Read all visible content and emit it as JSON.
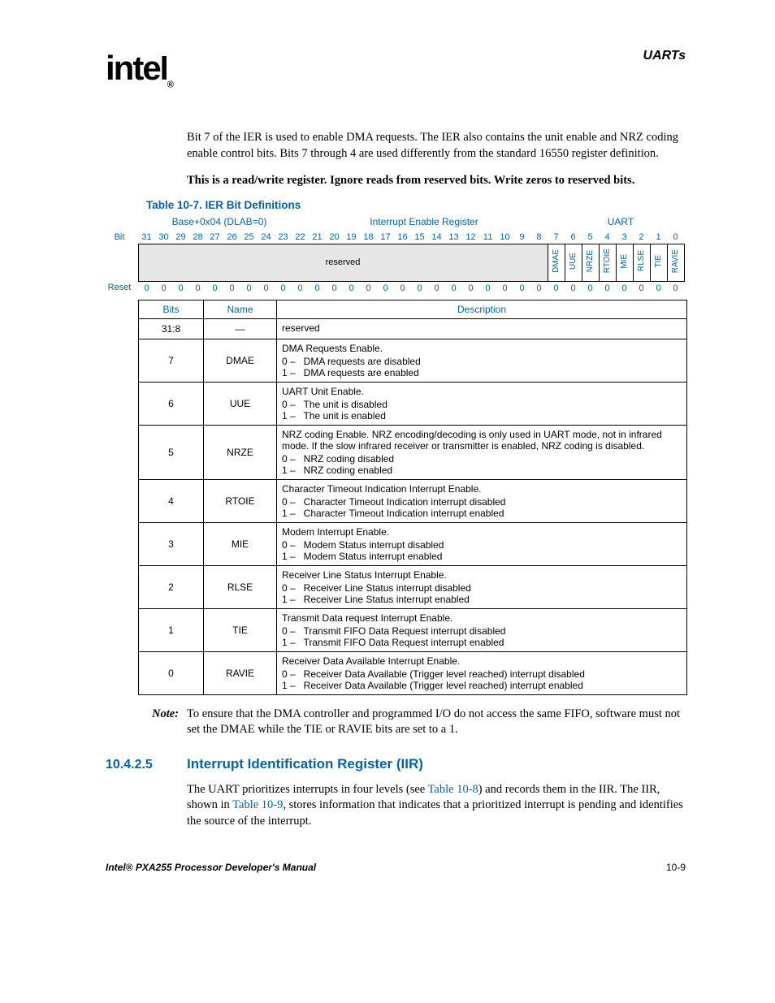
{
  "header": {
    "logo": "intel",
    "section": "UARTs"
  },
  "paras": {
    "p1": "Bit 7 of the IER is used to enable DMA requests. The IER also contains the unit enable and NRZ coding enable control bits. Bits 7 through 4 are used differently from the standard 16550 register definition.",
    "p2": "This is a read/write register. Ignore reads from reserved bits. Write zeros to reserved bits."
  },
  "table_caption": "Table 10-7. IER Bit Definitions",
  "reg_header": {
    "addr": "Base+0x04 (DLAB=0)",
    "name": "Interrupt Enable Register",
    "module": "UART"
  },
  "bit_labels": {
    "bit": "Bit",
    "reset": "Reset"
  },
  "bit_numbers": [
    "31",
    "30",
    "29",
    "28",
    "27",
    "26",
    "25",
    "24",
    "23",
    "22",
    "21",
    "20",
    "19",
    "18",
    "17",
    "16",
    "15",
    "14",
    "13",
    "12",
    "11",
    "10",
    "9",
    "8",
    "7",
    "6",
    "5",
    "4",
    "3",
    "2",
    "1",
    "0"
  ],
  "field_reserved": "reserved",
  "field_names": [
    "DMAE",
    "UUE",
    "NRZE",
    "RTOIE",
    "MIE",
    "RLSE",
    "TIE",
    "RAVIE"
  ],
  "reset_values": [
    "0",
    "0",
    "0",
    "0",
    "0",
    "0",
    "0",
    "0",
    "0",
    "0",
    "0",
    "0",
    "0",
    "0",
    "0",
    "0",
    "0",
    "0",
    "0",
    "0",
    "0",
    "0",
    "0",
    "0",
    "0",
    "0",
    "0",
    "0",
    "0",
    "0",
    "0",
    "0"
  ],
  "desc_headers": {
    "bits": "Bits",
    "name": "Name",
    "desc": "Description"
  },
  "rows": [
    {
      "bits": "31:8",
      "name": "—",
      "desc_title": "reserved",
      "opts": []
    },
    {
      "bits": "7",
      "name": "DMAE",
      "desc_title": "DMA Requests Enable.",
      "opts": [
        "0 –   DMA requests are disabled",
        "1 –   DMA requests are enabled"
      ]
    },
    {
      "bits": "6",
      "name": "UUE",
      "desc_title": "UART Unit Enable.",
      "opts": [
        "0 –   The unit is disabled",
        "1 –   The unit is enabled"
      ]
    },
    {
      "bits": "5",
      "name": "NRZE",
      "desc_title": "NRZ coding Enable. NRZ encoding/decoding is only used in UART mode, not in infrared mode. If the slow infrared receiver or transmitter is enabled, NRZ coding is disabled.",
      "opts": [
        "0 –   NRZ coding disabled",
        "1 –   NRZ coding enabled"
      ]
    },
    {
      "bits": "4",
      "name": "RTOIE",
      "desc_title": "Character Timeout Indication Interrupt Enable.",
      "opts": [
        "0 –   Character Timeout Indication interrupt disabled",
        "1 –   Character Timeout Indication interrupt enabled"
      ]
    },
    {
      "bits": "3",
      "name": "MIE",
      "desc_title": "Modem Interrupt Enable.",
      "opts": [
        "0 –   Modem Status interrupt disabled",
        "1 –   Modem Status interrupt enabled"
      ]
    },
    {
      "bits": "2",
      "name": "RLSE",
      "desc_title": "Receiver Line Status Interrupt Enable.",
      "opts": [
        "0 –   Receiver Line Status interrupt disabled",
        "1 –   Receiver Line Status interrupt enabled"
      ]
    },
    {
      "bits": "1",
      "name": "TIE",
      "desc_title": "Transmit Data request Interrupt Enable.",
      "opts": [
        "0 –   Transmit FIFO Data Request interrupt disabled",
        "1 –   Transmit FIFO Data Request interrupt enabled"
      ]
    },
    {
      "bits": "0",
      "name": "RAVIE",
      "desc_title": "Receiver Data Available Interrupt Enable.",
      "opts": [
        "0 –   Receiver Data Available (Trigger level reached) interrupt disabled",
        "1 –   Receiver Data Available (Trigger level reached) interrupt enabled"
      ]
    }
  ],
  "note": {
    "label": "Note:",
    "text_a": "To ensure that the DMA controller and programmed I/O do not access the same FIFO, software must not set the DMAE while the TIE or RAVIE bits are set to a 1."
  },
  "section": {
    "num": "10.4.2.5",
    "title": "Interrupt Identification Register (IIR)"
  },
  "iir_para": {
    "a": "The UART prioritizes interrupts in four levels (see ",
    "link1": "Table 10-8",
    "b": ") and records them in the IIR. The IIR, shown in ",
    "link2": "Table 10-9",
    "c": ", stores information that indicates that a prioritized interrupt is pending and identifies the source of the interrupt."
  },
  "footer": {
    "left": "Intel® PXA255 Processor Developer's Manual",
    "right": "10-9"
  }
}
